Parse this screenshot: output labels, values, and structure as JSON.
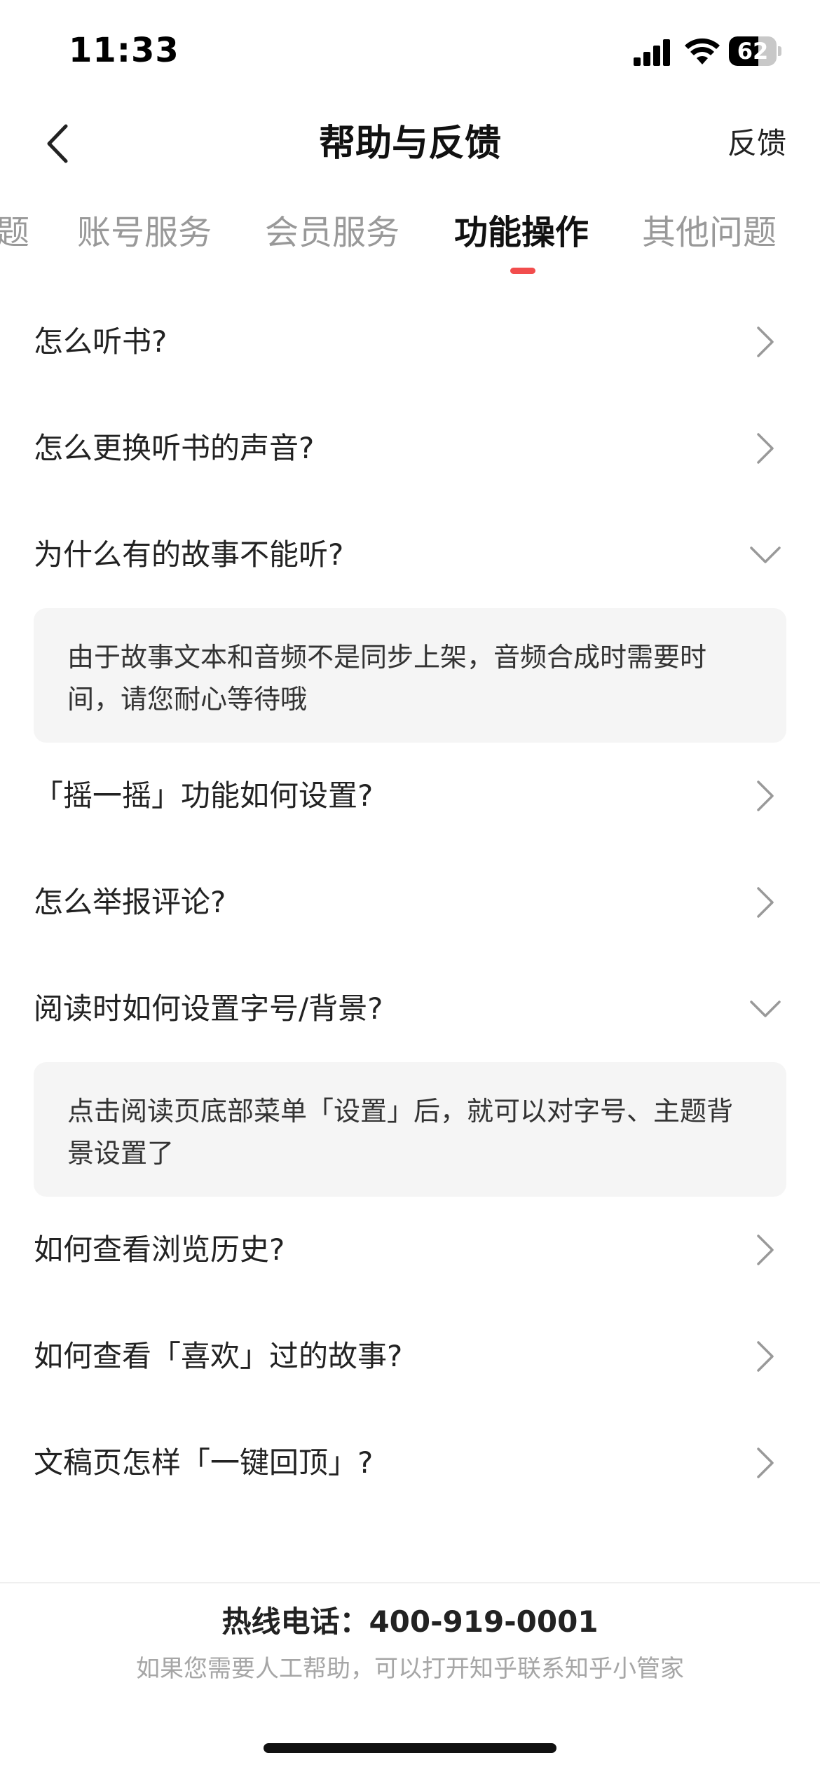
{
  "status_bar": {
    "time": "11:33",
    "battery_level": "62",
    "battery_fraction": 0.62
  },
  "nav": {
    "title": "帮助与反馈",
    "feedback_label": "反馈"
  },
  "tabs": [
    {
      "label": "题",
      "active": false
    },
    {
      "label": "账号服务",
      "active": false
    },
    {
      "label": "会员服务",
      "active": false
    },
    {
      "label": "功能操作",
      "active": true
    },
    {
      "label": "其他问题",
      "active": false
    }
  ],
  "faq": [
    {
      "question": "怎么听书?",
      "expanded": false,
      "answer": ""
    },
    {
      "question": "怎么更换听书的声音?",
      "expanded": false,
      "answer": ""
    },
    {
      "question": "为什么有的故事不能听?",
      "expanded": true,
      "answer": "由于故事文本和音频不是同步上架，音频合成时需要时间，请您耐心等待哦"
    },
    {
      "question": "「摇一摇」功能如何设置?",
      "expanded": false,
      "answer": ""
    },
    {
      "question": "怎么举报评论?",
      "expanded": false,
      "answer": ""
    },
    {
      "question": "阅读时如何设置字号/背景?",
      "expanded": true,
      "answer": "点击阅读页底部菜单「设置」后，就可以对字号、主题背景设置了"
    },
    {
      "question": "如何查看浏览历史?",
      "expanded": false,
      "answer": ""
    },
    {
      "question": "如何查看「喜欢」过的故事?",
      "expanded": false,
      "answer": ""
    },
    {
      "question": "文稿页怎样「一键回顶」?",
      "expanded": false,
      "answer": ""
    }
  ],
  "footer": {
    "hotline": "热线电话：400-919-0001",
    "help_text": "如果您需要人工帮助，可以打开知乎联系知乎小管家"
  },
  "colors": {
    "accent": "#f24d4d",
    "text_primary": "#222222",
    "text_muted": "#999999",
    "answer_bg": "#f5f5f5"
  }
}
